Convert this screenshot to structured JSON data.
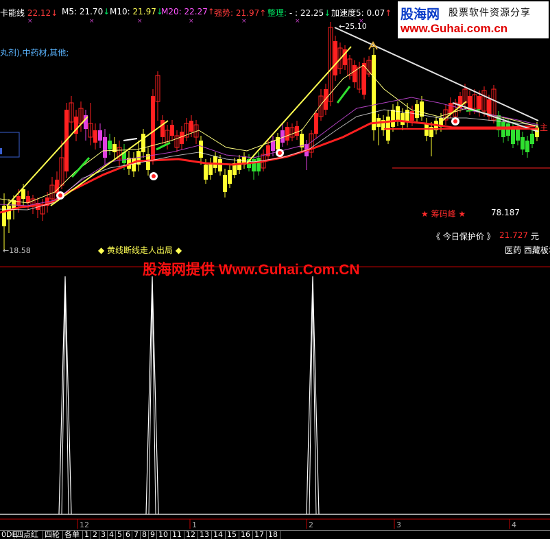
{
  "header": {
    "items": [
      {
        "label": "卡能线",
        "value": "22.12",
        "arrow": "↓",
        "label_color": "#ffffff",
        "value_color": "#ff3b3b",
        "arrow_color": "#ff3b3b"
      },
      {
        "label": "M5:",
        "value": "21.70",
        "arrow": "↓",
        "label_color": "#ffffff",
        "value_color": "#ffffff",
        "arrow_color": "#00e060"
      },
      {
        "label": "M10:",
        "value": "21.97",
        "arrow": "↓",
        "label_color": "#ffffff",
        "value_color": "#ffff55",
        "arrow_color": "#00e060"
      },
      {
        "label": "M20:",
        "value": "22.27",
        "arrow": "↑",
        "label_color": "#ff55ff",
        "value_color": "#ff55ff",
        "arrow_color": "#ff3b3b"
      },
      {
        "label": "强势:",
        "value": "21.97",
        "arrow": "↑",
        "label_color": "#ff3b3b",
        "value_color": "#ff3b3b",
        "arrow_color": "#ff3b3b"
      },
      {
        "label": "整理:",
        "value": "- : 22.25",
        "arrow": "↓",
        "label_color": "#00e060",
        "value_color": "#ffffff",
        "arrow_color": "#00e060"
      },
      {
        "label": "加速度5:",
        "value": "0.07",
        "arrow": "↑",
        "label_color": "#ffffff",
        "value_color": "#ffffff",
        "arrow_color": "#ff3b3b"
      }
    ]
  },
  "logo": {
    "site_name": "股海网",
    "tagline": "股票软件资源分享",
    "url": "www.Guhai.com.cn"
  },
  "sector_text": "丸剂),中药材,其他;",
  "price_high_label": "25.10",
  "price_low_label": "18.58",
  "chip_peak_label": "★ 筹码峰 ★",
  "chip_peak_value": "78.187",
  "protect_price_label": "《 今日保护价 》",
  "protect_price_value": "21.727",
  "protect_price_unit": "元",
  "signal_caption": "◆ 黄线断线走人出局 ◆",
  "sector_tags": "医药  西藏板块",
  "trend_right_label": "主",
  "watermark": "股海网提供 Www.Guhai.Com.CN",
  "x_axis_labels": [
    "12",
    "1",
    "2",
    "3",
    "4"
  ],
  "bottom_tabs": [
    "0DE",
    "四点红",
    "四轮",
    "各单",
    "1",
    "2",
    "3",
    "4",
    "5",
    "6",
    "7",
    "8",
    "9",
    "10",
    "11",
    "12",
    "13",
    "14",
    "15",
    "16",
    "17",
    "18"
  ],
  "colors": {
    "background": "#000000",
    "up_candle": "#ff2020",
    "down_candle": "#ffff30",
    "accel_candle": "#e040e0",
    "green_candle": "#30e030",
    "ma_red": "#ff2020",
    "ma_yellow": "#ffff80",
    "ma_purple": "#b040c0",
    "trend_line": "#ffff50",
    "grid_red": "#c00000"
  }
}
